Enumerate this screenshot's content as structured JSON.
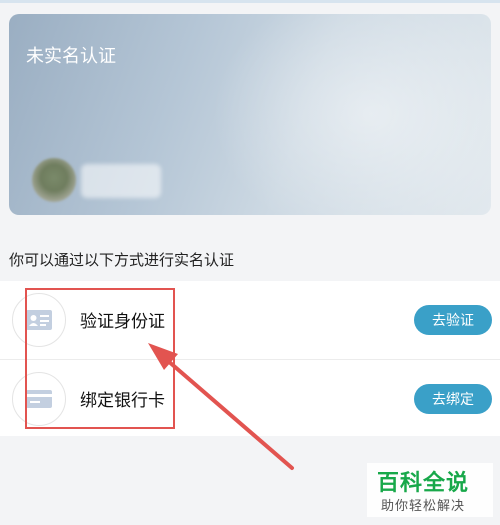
{
  "card": {
    "status": "未实名认证"
  },
  "hint": "你可以通过以下方式进行实名认证",
  "options": [
    {
      "label": "验证身份证",
      "button": "去验证",
      "icon": "id-card-icon"
    },
    {
      "label": "绑定银行卡",
      "button": "去绑定",
      "icon": "bank-card-icon"
    }
  ],
  "watermark": {
    "title": "百科全说",
    "subtitle": "助你轻松解决"
  },
  "colors": {
    "button": "#3aa0c8",
    "annotation": "#e25450",
    "watermark": "#18a84a"
  }
}
